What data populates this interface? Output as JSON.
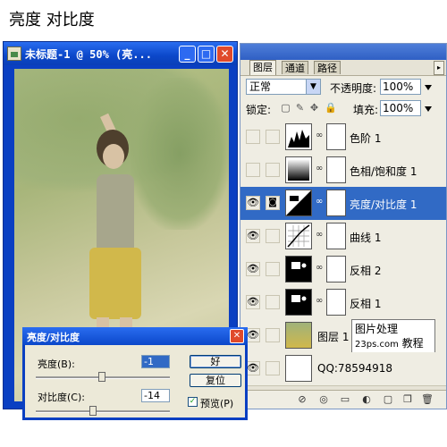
{
  "heading": "亮度 对比度",
  "document": {
    "title": "未标题-1 @ 50% (亮...",
    "minimize_label": "_",
    "maximize_label": "□",
    "close_label": "✕"
  },
  "layers_panel": {
    "tabs": [
      {
        "label": "图层",
        "active": true
      },
      {
        "label": "通道",
        "active": false
      },
      {
        "label": "路径",
        "active": false
      }
    ],
    "blend_mode": "正常",
    "opacity_label": "不透明度:",
    "opacity_value": "100%",
    "lock_label": "锁定:",
    "fill_label": "填充:",
    "fill_value": "100%",
    "layers": [
      {
        "name": "色阶 1",
        "visible": false,
        "selected": false,
        "thumb": "levels-icon",
        "has_mask": true
      },
      {
        "name": "色相/饱和度 1",
        "visible": false,
        "selected": false,
        "thumb": "hue-saturation-icon",
        "has_mask": true
      },
      {
        "name": "亮度/对比度 1",
        "visible": true,
        "selected": true,
        "thumb": "brightness-contrast-icon",
        "has_mask": true
      },
      {
        "name": "曲线 1",
        "visible": true,
        "selected": false,
        "thumb": "curves-icon",
        "has_mask": true
      },
      {
        "name": "反相 2",
        "visible": true,
        "selected": false,
        "thumb": "invert-icon",
        "has_mask": true
      },
      {
        "name": "反相 1",
        "visible": true,
        "selected": false,
        "thumb": "invert-icon",
        "has_mask": true
      },
      {
        "name": "图层 1",
        "visible": true,
        "selected": false,
        "thumb": "photo-thumb",
        "has_mask": false
      },
      {
        "name": "QQ:78594918",
        "visible": true,
        "selected": false,
        "thumb": "blank-thumb",
        "has_mask": false
      }
    ],
    "watermark": {
      "line1": "图片处理",
      "line2": "23ps.com",
      "line3": "教程网"
    }
  },
  "dialog": {
    "title": "亮度/对比度",
    "brightness_label": "亮度(B):",
    "brightness_value": "-1",
    "contrast_label": "对比度(C):",
    "contrast_value": "-14",
    "ok_label": "好",
    "reset_label": "复位",
    "preview_label": "预览(P)",
    "preview_checked": true
  }
}
